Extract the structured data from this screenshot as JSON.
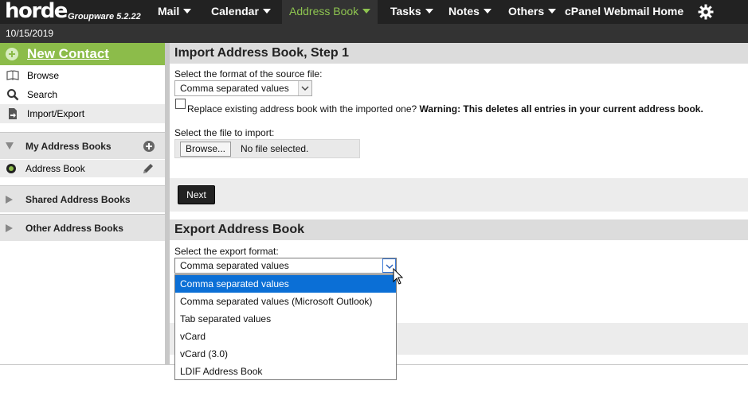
{
  "app": {
    "logo": "horde",
    "logo_sub": "Groupware 5.2.22"
  },
  "nav": {
    "items": [
      {
        "label": "Mail"
      },
      {
        "label": "Calendar"
      },
      {
        "label": "Address Book",
        "active": true
      },
      {
        "label": "Tasks"
      },
      {
        "label": "Notes"
      },
      {
        "label": "Others"
      }
    ],
    "cpanel_label": "cPanel Webmail Home",
    "settings_icon": "gear-icon"
  },
  "date": "10/15/2019",
  "sidebar": {
    "new_contact": "New Contact",
    "links": [
      {
        "label": "Browse",
        "icon": "book-icon"
      },
      {
        "label": "Search",
        "icon": "search-icon"
      },
      {
        "label": "Import/Export",
        "icon": "import-export-icon",
        "selected": true
      }
    ],
    "groups": {
      "my": "My Address Books",
      "shared": "Shared Address Books",
      "other": "Other Address Books"
    },
    "address_book": "Address Book"
  },
  "import": {
    "title": "Import Address Book, Step 1",
    "format_label": "Select the format of the source file:",
    "format_value": "Comma separated values",
    "replace_label": "Replace existing address book with the imported one?",
    "warning": "Warning: This deletes all entries in your current address book.",
    "file_label": "Select the file to import:",
    "browse": "Browse...",
    "no_file": "No file selected.",
    "next": "Next"
  },
  "export": {
    "title": "Export Address Book",
    "format_label": "Select the export format:",
    "format_value": "Comma separated values",
    "options": [
      "Comma separated values",
      "Comma separated values (Microsoft Outlook)",
      "Tab separated values",
      "vCard",
      "vCard (3.0)",
      "LDIF Address Book"
    ],
    "highlighted_index": 0
  },
  "colors": {
    "topbar": "#222222",
    "accent_green": "#8cbc4a",
    "highlight_blue": "#0b6fd6"
  }
}
